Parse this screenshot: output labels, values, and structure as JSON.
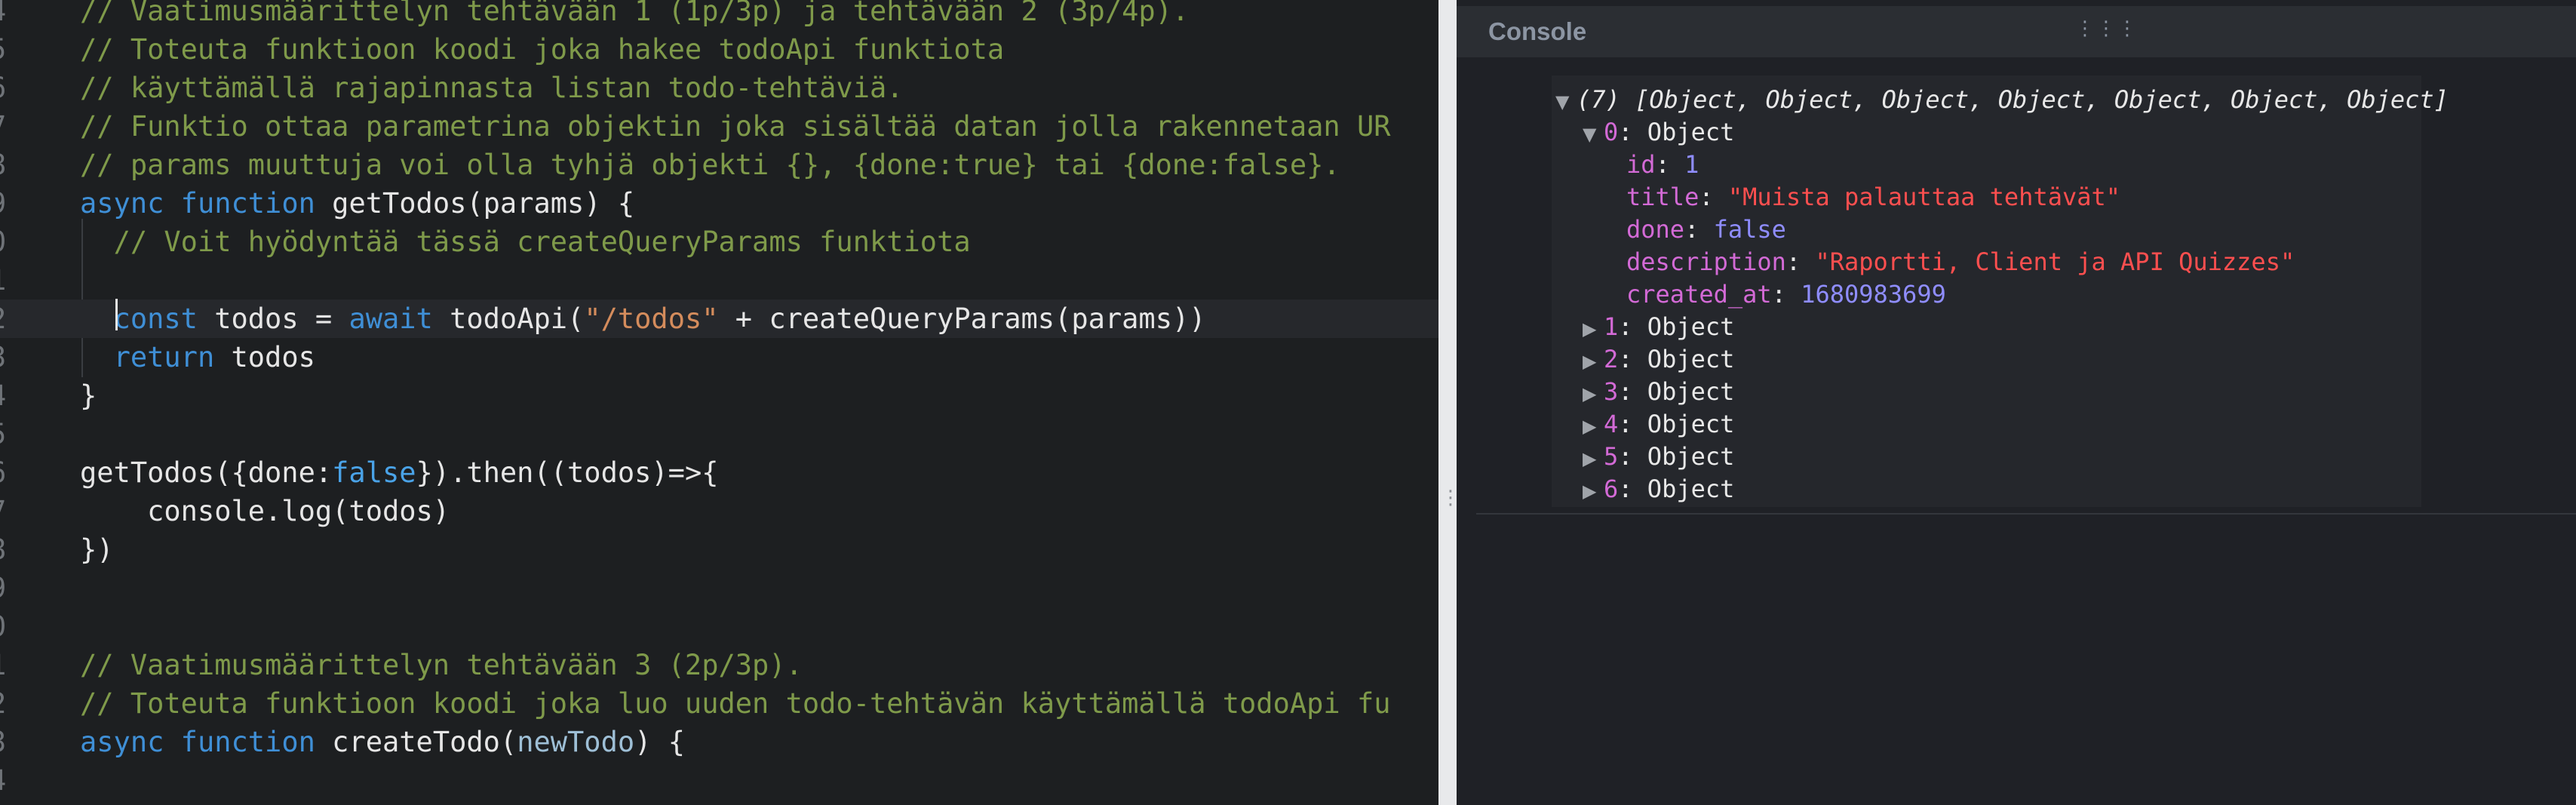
{
  "editor": {
    "lines": [
      {
        "num": "4",
        "parts": [
          {
            "t": "// Vaatimusmäärittelyn tehtävään 1 (1p/3p) ja tehtävään 2 (3p/4p).",
            "c": "c"
          }
        ]
      },
      {
        "num": "5",
        "parts": [
          {
            "t": "// Toteuta funktioon koodi joka hakee todoApi funktiota",
            "c": "c"
          }
        ]
      },
      {
        "num": "6",
        "parts": [
          {
            "t": "// käyttämällä rajapinnasta listan todo-tehtäviä.",
            "c": "c"
          }
        ]
      },
      {
        "num": "7",
        "parts": [
          {
            "t": "// Funktio ottaa parametrina objektin joka sisältää datan jolla rakennetaan UR",
            "c": "c"
          }
        ]
      },
      {
        "num": "8",
        "parts": [
          {
            "t": "// params muuttuja voi olla tyhjä objekti {}, {done:true} tai {done:false}.",
            "c": "c"
          }
        ]
      },
      {
        "num": "9",
        "parts": [
          {
            "t": "async",
            "c": "k"
          },
          {
            "t": " "
          },
          {
            "t": "function",
            "c": "k"
          },
          {
            "t": " getTodos(params) {"
          }
        ]
      },
      {
        "num": "0",
        "parts": [
          {
            "t": "  "
          },
          {
            "t": "// Voit hyödyntää tässä createQueryParams funktiota",
            "c": "c"
          }
        ]
      },
      {
        "num": "1",
        "parts": []
      },
      {
        "num": "2",
        "current": true,
        "parts": [
          {
            "t": "  "
          },
          {
            "t": "const",
            "c": "k"
          },
          {
            "t": " todos = "
          },
          {
            "t": "await",
            "c": "k"
          },
          {
            "t": " todoApi("
          },
          {
            "t": "\"/todos\"",
            "c": "s"
          },
          {
            "t": " + createQueryParams(params))"
          }
        ]
      },
      {
        "num": "3",
        "parts": [
          {
            "t": "  "
          },
          {
            "t": "return",
            "c": "k"
          },
          {
            "t": " todos"
          }
        ]
      },
      {
        "num": "4",
        "parts": [
          {
            "t": "}"
          }
        ]
      },
      {
        "num": "5",
        "parts": []
      },
      {
        "num": "6",
        "parts": [
          {
            "t": "getTodos({done:"
          },
          {
            "t": "false",
            "c": "b"
          },
          {
            "t": "}).then((todos)=>{"
          }
        ]
      },
      {
        "num": "7",
        "parts": [
          {
            "t": "    console.log(todos)"
          }
        ]
      },
      {
        "num": "8",
        "parts": [
          {
            "t": "})"
          }
        ]
      },
      {
        "num": "9",
        "parts": []
      },
      {
        "num": "0",
        "parts": []
      },
      {
        "num": "1",
        "parts": [
          {
            "t": "// Vaatimusmäärittelyn tehtävään 3 (2p/3p).",
            "c": "c"
          }
        ]
      },
      {
        "num": "2",
        "parts": [
          {
            "t": "// Toteuta funktioon koodi joka luo uuden todo-tehtävän käyttämällä todoApi fu",
            "c": "c"
          }
        ]
      },
      {
        "num": "3",
        "parts": [
          {
            "t": "async",
            "c": "k"
          },
          {
            "t": " "
          },
          {
            "t": "function",
            "c": "k"
          },
          {
            "t": " createTodo("
          },
          {
            "t": "newTodo",
            "c": "p"
          },
          {
            "t": ") {"
          }
        ]
      },
      {
        "num": "4",
        "parts": []
      }
    ]
  },
  "console": {
    "title": "Console",
    "menu_glyph": "⋮⋮⋮",
    "summary_arrow": "▼",
    "summary": "(7) [Object, Object, Object, Object, Object, Object, Object]",
    "expanded_item": {
      "arrow": "▼",
      "index": "0",
      "type": "Object",
      "props": [
        {
          "key": "id",
          "value": "1",
          "kind": "num"
        },
        {
          "key": "title",
          "value": "\"Muista palauttaa tehtävät\"",
          "kind": "str"
        },
        {
          "key": "done",
          "value": "false",
          "kind": "bool"
        },
        {
          "key": "description",
          "value": "\"Raportti, Client ja API Quizzes\"",
          "kind": "str"
        },
        {
          "key": "created_at",
          "value": "1680983699",
          "kind": "num"
        }
      ]
    },
    "collapsed_arrow": "▶",
    "collapsed_items": [
      {
        "index": "1",
        "type": "Object"
      },
      {
        "index": "2",
        "type": "Object"
      },
      {
        "index": "3",
        "type": "Object"
      },
      {
        "index": "4",
        "type": "Object"
      },
      {
        "index": "5",
        "type": "Object"
      },
      {
        "index": "6",
        "type": "Object"
      }
    ]
  },
  "splitter": {
    "grip": "⋮"
  }
}
